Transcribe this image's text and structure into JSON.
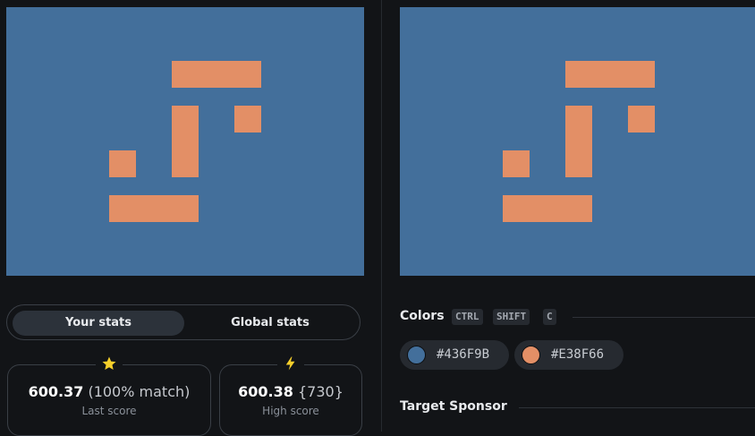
{
  "colors_section": {
    "title": "Colors",
    "shortcut": [
      "CTRL",
      "SHIFT",
      "C"
    ],
    "swatches": [
      {
        "hex": "#436F9B",
        "color": "#436F9B"
      },
      {
        "hex": "#E38F66",
        "color": "#E38F66"
      }
    ]
  },
  "stats_tabs": {
    "your": "Your stats",
    "global": "Global stats"
  },
  "last_score": {
    "value": "600.37",
    "detail": "(100% match)",
    "label": "Last score",
    "icon": "star-icon"
  },
  "high_score": {
    "value": "600.38",
    "detail": "{730}",
    "label": "High score",
    "icon": "lightning-icon"
  },
  "target_sponsor": {
    "title": "Target Sponsor"
  },
  "palette": {
    "background": "#436F9B",
    "shape": "#E38F66",
    "star": "#f5cf2b",
    "bolt": "#f5cf2b"
  }
}
